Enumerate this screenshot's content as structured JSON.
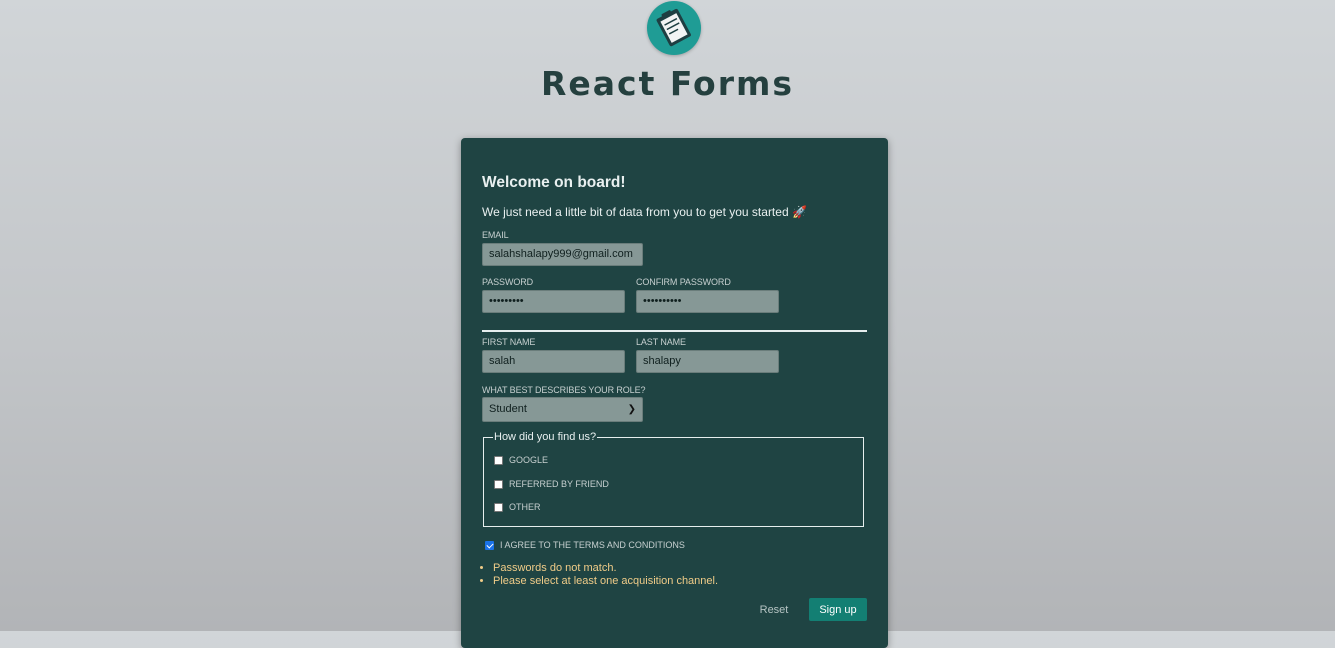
{
  "header": {
    "title": "React Forms",
    "logo_icon": "clipboard-form-icon"
  },
  "form": {
    "welcome": "Welcome on board!",
    "subtitle": "We just need a little bit of data from you to get you started 🚀",
    "email": {
      "label": "Email",
      "value": "salahshalapy999@gmail.com"
    },
    "password": {
      "label": "Password",
      "value": "•••••••••"
    },
    "confirm_password": {
      "label": "Confirm Password",
      "value": "••••••••••"
    },
    "first_name": {
      "label": "First Name",
      "value": "salah"
    },
    "last_name": {
      "label": "Last Name",
      "value": "shalapy"
    },
    "role": {
      "label": "What best describes your role?",
      "value": "Student"
    },
    "acquisition": {
      "legend": "How did you find us?",
      "options": [
        {
          "label": "Google",
          "checked": false
        },
        {
          "label": "Referred by friend",
          "checked": false
        },
        {
          "label": "Other",
          "checked": false
        }
      ]
    },
    "terms": {
      "label": "I agree to the terms and conditions",
      "checked": true
    },
    "errors": [
      "Passwords do not match.",
      "Please select at least one acquisition channel."
    ],
    "buttons": {
      "reset": "Reset",
      "signup": "Sign up"
    }
  },
  "colors": {
    "card_bg": "#1f4443",
    "accent": "#137f73",
    "error": "#f0cc88",
    "logo_bg": "#1f9c95"
  }
}
